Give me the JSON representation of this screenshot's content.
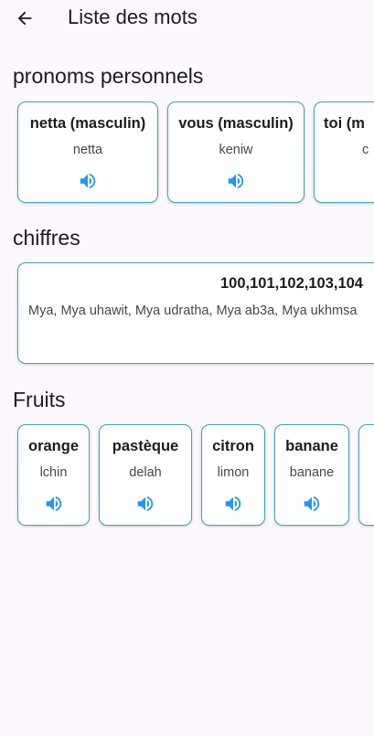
{
  "app_bar": {
    "title": "Liste des mots",
    "back_icon": "arrow-back-icon"
  },
  "speaker_icon": "volume-up-icon",
  "colors": {
    "background": "#fdf7fe",
    "card_border": "#39a5b5",
    "speaker": "#2196f3"
  },
  "sections": {
    "pronouns": {
      "title": "pronoms personnels",
      "cards": [
        {
          "label": "netta (masculin)",
          "translit": "netta"
        },
        {
          "label": "vous (masculin)",
          "translit": "keniw"
        },
        {
          "label": "toi (m",
          "translit": "c"
        }
      ]
    },
    "numbers": {
      "title": "chiffres",
      "cards": [
        {
          "label": "100,101,102,103,104",
          "translit": "Mya, Mya uhawit, Mya udratha, Mya ab3a, Mya ukhmsa"
        }
      ]
    },
    "fruits": {
      "title": "Fruits",
      "cards": [
        {
          "label": "orange",
          "translit": "lchin"
        },
        {
          "label": "pastèque",
          "translit": "delah"
        },
        {
          "label": "citron",
          "translit": "limon"
        },
        {
          "label": "banane",
          "translit": "banane"
        }
      ]
    }
  }
}
